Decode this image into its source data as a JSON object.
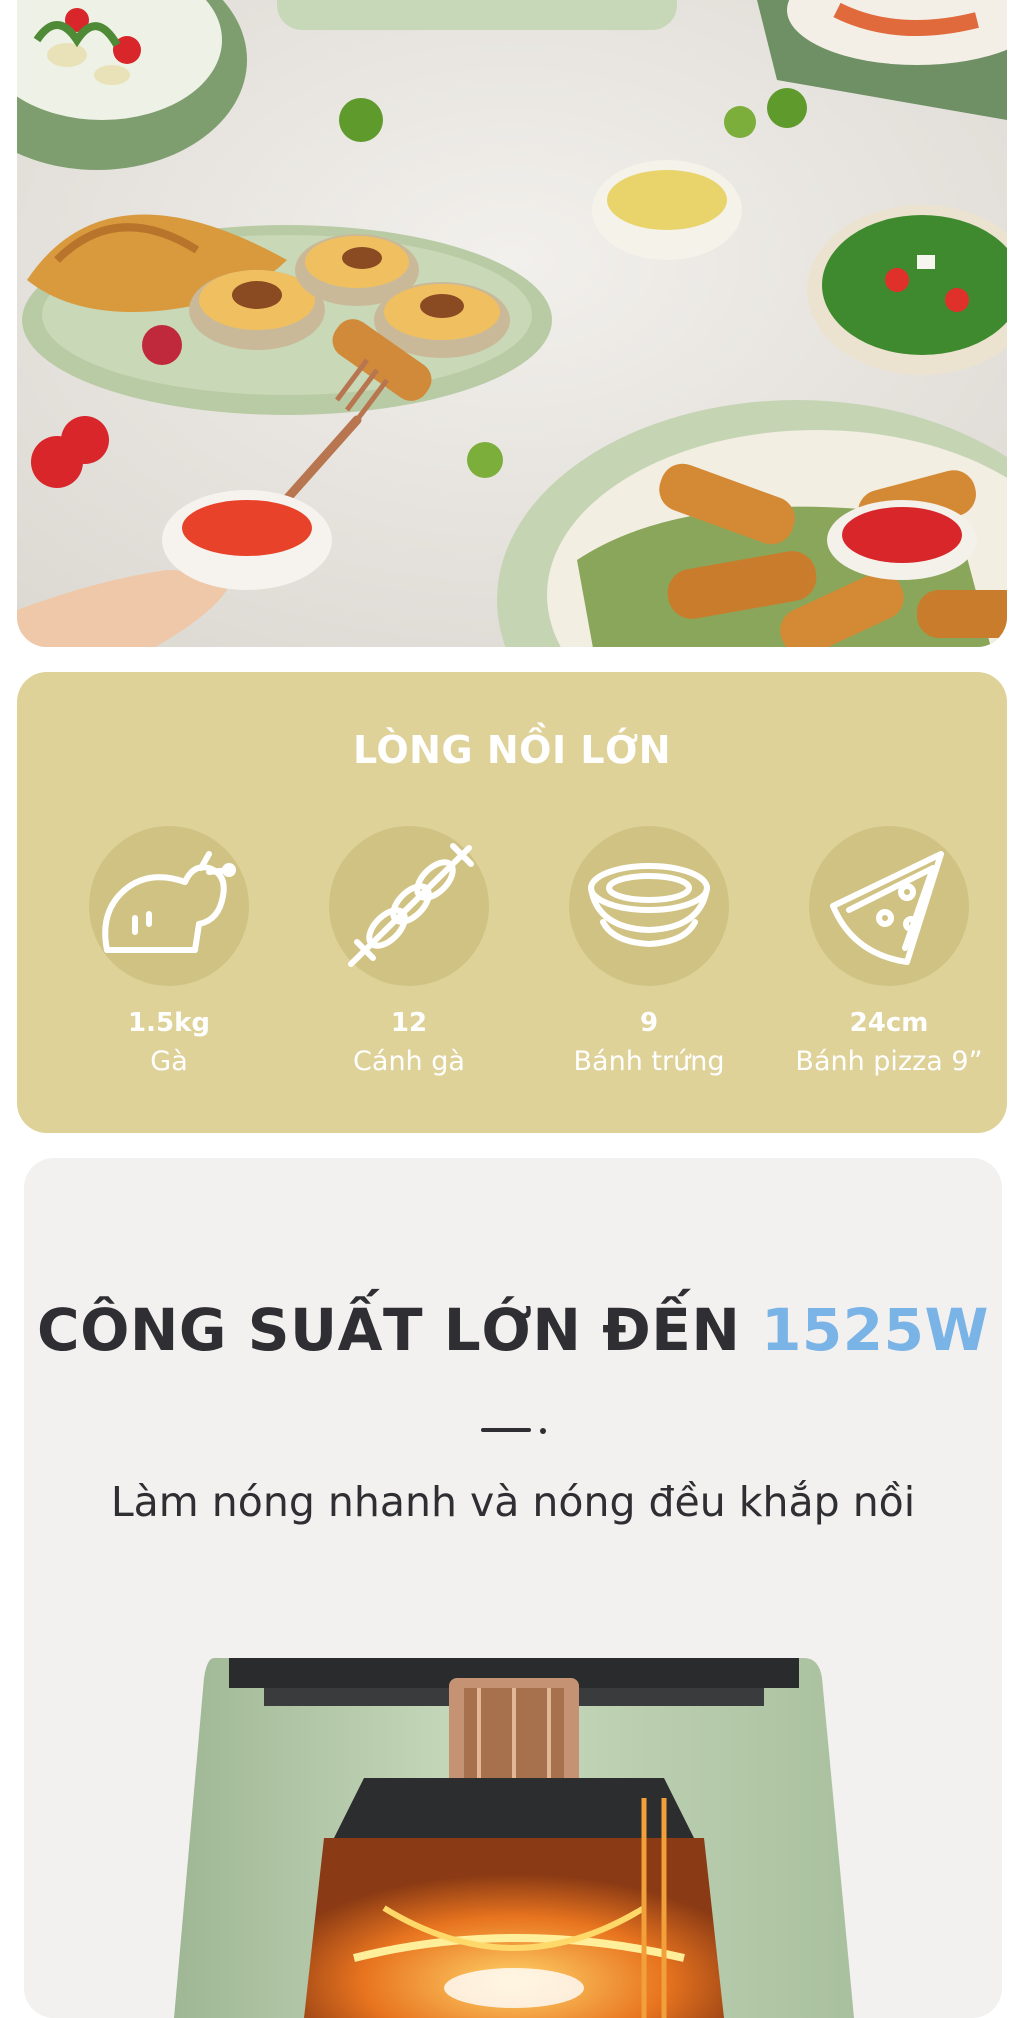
{
  "capacity": {
    "title": "LÒNG NỒI LỚN",
    "items": [
      {
        "icon": "chicken-icon",
        "value": "1.5kg",
        "label": "Gà"
      },
      {
        "icon": "skewer-icon",
        "value": "12",
        "label": "Cánh gà"
      },
      {
        "icon": "egg-tart-icon",
        "value": "9",
        "label": "Bánh trứng"
      },
      {
        "icon": "pizza-icon",
        "value": "24cm",
        "label": "Bánh pizza 9”"
      }
    ]
  },
  "power": {
    "title": "CÔNG SUẤT LỚN ĐẾN",
    "title_accent": "1525W",
    "subtitle": "Làm nóng nhanh và nóng đều khắp nồi"
  },
  "colors": {
    "panel": "#ded299",
    "circle": "#cfc282",
    "accent": "#7ab3e6",
    "text_dark": "#2f2f33",
    "appliance_green": "#b8cfae"
  }
}
